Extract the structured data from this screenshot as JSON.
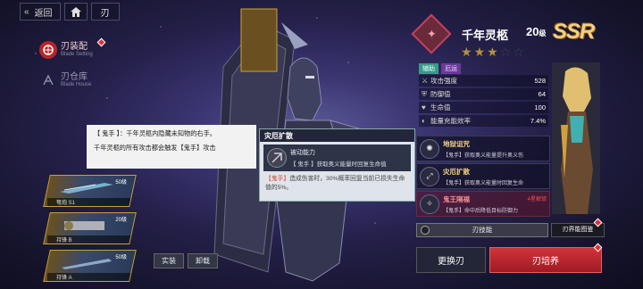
{
  "topbar": {
    "back_label": "返回",
    "crumb_label": "刃"
  },
  "nav": [
    {
      "cn": "刃装配",
      "en": "Blade Setting",
      "active": true
    },
    {
      "cn": "刃仓库",
      "en": "Blade House",
      "active": false
    }
  ],
  "tooltip": {
    "line1": "【 鬼手 】：千年灵柩内隐藏未知物的右手。",
    "line2": "千年灵柩的所有攻击都会触发【鬼手】攻击"
  },
  "skill_popup": {
    "title": "灾厄扩散",
    "passive_label": "被动能力",
    "passive_desc": "【 鬼手 】获取奥义能量时回复生命值",
    "detail_prefix": "【鬼手】",
    "detail_text": "造成伤害时，30%概率回复当前已损失生命值的5%。"
  },
  "weapons": [
    {
      "level": "50级",
      "name": "弩炮 S1"
    },
    {
      "level": "20级",
      "name": "持锋 B"
    },
    {
      "level": "50级",
      "name": "持锋 A"
    }
  ],
  "equip_buttons": {
    "equip": "实装",
    "unload": "卸载"
  },
  "character": {
    "name": "千年灵柩",
    "level": "20",
    "level_unit": "级",
    "rarity": "SSR",
    "stars_on": 3,
    "stars_total": 5,
    "tags": [
      "辅助",
      "厄运"
    ],
    "stats": [
      {
        "icon": "sword-icon",
        "label": "攻击强度",
        "value": "528"
      },
      {
        "icon": "shield-icon",
        "label": "防御值",
        "value": "64"
      },
      {
        "icon": "heart-icon",
        "label": "生命值",
        "value": "100"
      },
      {
        "icon": "energy-icon",
        "label": "能量充能效率",
        "value": "7.4%"
      }
    ]
  },
  "skills": [
    {
      "name": "地狱诅咒",
      "desc": "【鬼手】获取奥义能量提升奥义伤",
      "locked": false,
      "lock_text": ""
    },
    {
      "name": "灾厄扩散",
      "desc": "【鬼手】获取奥义能量时回复生命",
      "locked": false,
      "lock_text": ""
    },
    {
      "name": "鬼王隔福",
      "desc": "【鬼手】命中后降低目标防御力",
      "locked": true,
      "lock_text": "4星解锁"
    }
  ],
  "skill_button": "刃技能",
  "gallery_button": "刃界能图鉴",
  "actions": {
    "swap": "更换刃",
    "train": "刃培养"
  },
  "colors": {
    "accent_red": "#c8242c",
    "star_gold": "#f0c040",
    "tag_green": "#3a9a8a",
    "tag_purple": "#6a3a9a"
  }
}
